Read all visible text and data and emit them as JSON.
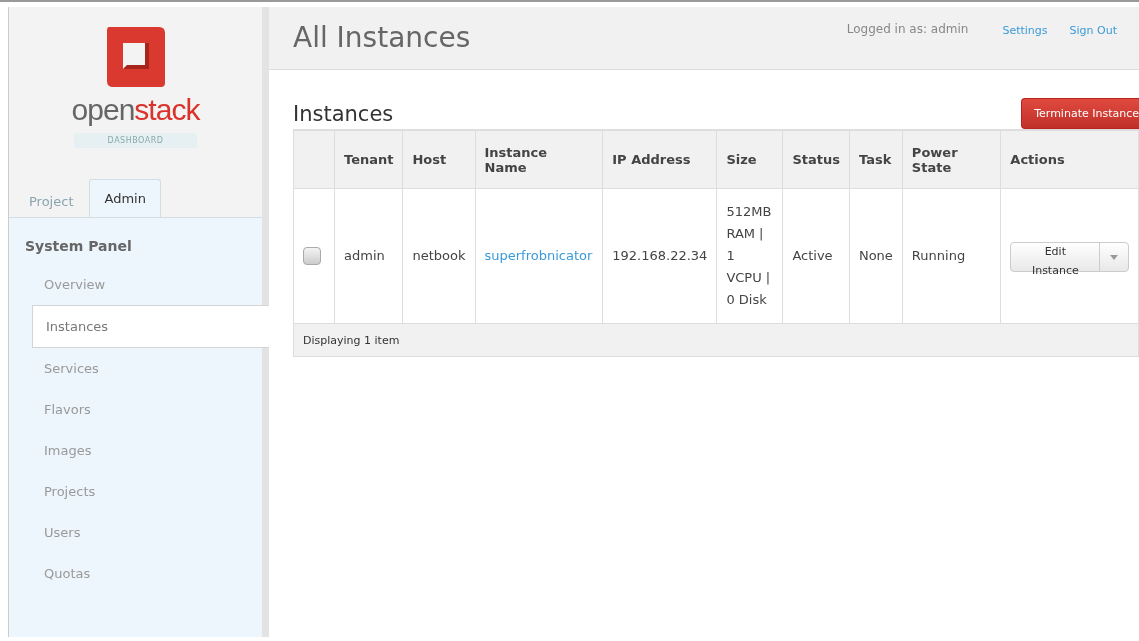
{
  "brand": {
    "word_start": "open",
    "word_end": "stack",
    "badge": "DASHBOARD"
  },
  "dashboard_tabs": [
    {
      "label": "Project",
      "selected": false
    },
    {
      "label": "Admin",
      "selected": true
    }
  ],
  "panel": {
    "title": "System Panel",
    "items": [
      {
        "label": "Overview",
        "selected": false
      },
      {
        "label": "Instances",
        "selected": true
      },
      {
        "label": "Services",
        "selected": false
      },
      {
        "label": "Flavors",
        "selected": false
      },
      {
        "label": "Images",
        "selected": false
      },
      {
        "label": "Projects",
        "selected": false
      },
      {
        "label": "Users",
        "selected": false
      },
      {
        "label": "Quotas",
        "selected": false
      }
    ]
  },
  "header": {
    "title": "All Instances",
    "user": "Logged in as: admin",
    "links": [
      "Settings",
      "Sign Out"
    ]
  },
  "section": {
    "title": "Instances",
    "action": "Terminate Instance"
  },
  "table": {
    "columns": [
      "Tenant",
      "Host",
      "Instance Name",
      "IP Address",
      "Size",
      "Status",
      "Task",
      "Power State",
      "Actions"
    ],
    "rows": [
      {
        "checked": false,
        "tenant": "admin",
        "host": "netbook",
        "name": "superfrobnicator",
        "ip": "192.168.22.34",
        "size": "512MB RAM | 1 VCPU | 0 Disk",
        "status": "Active",
        "task": "None",
        "power_state": "Running",
        "action": "Edit Instance"
      }
    ],
    "footer": "Displaying 1 item"
  }
}
